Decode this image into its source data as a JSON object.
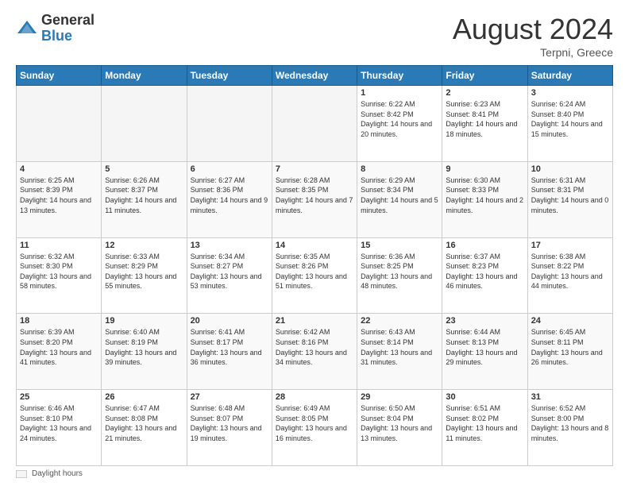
{
  "header": {
    "logo_general": "General",
    "logo_blue": "Blue",
    "month_year": "August 2024",
    "location": "Terpni, Greece"
  },
  "days_of_week": [
    "Sunday",
    "Monday",
    "Tuesday",
    "Wednesday",
    "Thursday",
    "Friday",
    "Saturday"
  ],
  "weeks": [
    [
      {
        "day": "",
        "info": ""
      },
      {
        "day": "",
        "info": ""
      },
      {
        "day": "",
        "info": ""
      },
      {
        "day": "",
        "info": ""
      },
      {
        "day": "1",
        "info": "Sunrise: 6:22 AM\nSunset: 8:42 PM\nDaylight: 14 hours and 20 minutes."
      },
      {
        "day": "2",
        "info": "Sunrise: 6:23 AM\nSunset: 8:41 PM\nDaylight: 14 hours and 18 minutes."
      },
      {
        "day": "3",
        "info": "Sunrise: 6:24 AM\nSunset: 8:40 PM\nDaylight: 14 hours and 15 minutes."
      }
    ],
    [
      {
        "day": "4",
        "info": "Sunrise: 6:25 AM\nSunset: 8:39 PM\nDaylight: 14 hours and 13 minutes."
      },
      {
        "day": "5",
        "info": "Sunrise: 6:26 AM\nSunset: 8:37 PM\nDaylight: 14 hours and 11 minutes."
      },
      {
        "day": "6",
        "info": "Sunrise: 6:27 AM\nSunset: 8:36 PM\nDaylight: 14 hours and 9 minutes."
      },
      {
        "day": "7",
        "info": "Sunrise: 6:28 AM\nSunset: 8:35 PM\nDaylight: 14 hours and 7 minutes."
      },
      {
        "day": "8",
        "info": "Sunrise: 6:29 AM\nSunset: 8:34 PM\nDaylight: 14 hours and 5 minutes."
      },
      {
        "day": "9",
        "info": "Sunrise: 6:30 AM\nSunset: 8:33 PM\nDaylight: 14 hours and 2 minutes."
      },
      {
        "day": "10",
        "info": "Sunrise: 6:31 AM\nSunset: 8:31 PM\nDaylight: 14 hours and 0 minutes."
      }
    ],
    [
      {
        "day": "11",
        "info": "Sunrise: 6:32 AM\nSunset: 8:30 PM\nDaylight: 13 hours and 58 minutes."
      },
      {
        "day": "12",
        "info": "Sunrise: 6:33 AM\nSunset: 8:29 PM\nDaylight: 13 hours and 55 minutes."
      },
      {
        "day": "13",
        "info": "Sunrise: 6:34 AM\nSunset: 8:27 PM\nDaylight: 13 hours and 53 minutes."
      },
      {
        "day": "14",
        "info": "Sunrise: 6:35 AM\nSunset: 8:26 PM\nDaylight: 13 hours and 51 minutes."
      },
      {
        "day": "15",
        "info": "Sunrise: 6:36 AM\nSunset: 8:25 PM\nDaylight: 13 hours and 48 minutes."
      },
      {
        "day": "16",
        "info": "Sunrise: 6:37 AM\nSunset: 8:23 PM\nDaylight: 13 hours and 46 minutes."
      },
      {
        "day": "17",
        "info": "Sunrise: 6:38 AM\nSunset: 8:22 PM\nDaylight: 13 hours and 44 minutes."
      }
    ],
    [
      {
        "day": "18",
        "info": "Sunrise: 6:39 AM\nSunset: 8:20 PM\nDaylight: 13 hours and 41 minutes."
      },
      {
        "day": "19",
        "info": "Sunrise: 6:40 AM\nSunset: 8:19 PM\nDaylight: 13 hours and 39 minutes."
      },
      {
        "day": "20",
        "info": "Sunrise: 6:41 AM\nSunset: 8:17 PM\nDaylight: 13 hours and 36 minutes."
      },
      {
        "day": "21",
        "info": "Sunrise: 6:42 AM\nSunset: 8:16 PM\nDaylight: 13 hours and 34 minutes."
      },
      {
        "day": "22",
        "info": "Sunrise: 6:43 AM\nSunset: 8:14 PM\nDaylight: 13 hours and 31 minutes."
      },
      {
        "day": "23",
        "info": "Sunrise: 6:44 AM\nSunset: 8:13 PM\nDaylight: 13 hours and 29 minutes."
      },
      {
        "day": "24",
        "info": "Sunrise: 6:45 AM\nSunset: 8:11 PM\nDaylight: 13 hours and 26 minutes."
      }
    ],
    [
      {
        "day": "25",
        "info": "Sunrise: 6:46 AM\nSunset: 8:10 PM\nDaylight: 13 hours and 24 minutes."
      },
      {
        "day": "26",
        "info": "Sunrise: 6:47 AM\nSunset: 8:08 PM\nDaylight: 13 hours and 21 minutes."
      },
      {
        "day": "27",
        "info": "Sunrise: 6:48 AM\nSunset: 8:07 PM\nDaylight: 13 hours and 19 minutes."
      },
      {
        "day": "28",
        "info": "Sunrise: 6:49 AM\nSunset: 8:05 PM\nDaylight: 13 hours and 16 minutes."
      },
      {
        "day": "29",
        "info": "Sunrise: 6:50 AM\nSunset: 8:04 PM\nDaylight: 13 hours and 13 minutes."
      },
      {
        "day": "30",
        "info": "Sunrise: 6:51 AM\nSunset: 8:02 PM\nDaylight: 13 hours and 11 minutes."
      },
      {
        "day": "31",
        "info": "Sunrise: 6:52 AM\nSunset: 8:00 PM\nDaylight: 13 hours and 8 minutes."
      }
    ]
  ],
  "footer": {
    "note": "Daylight hours"
  }
}
